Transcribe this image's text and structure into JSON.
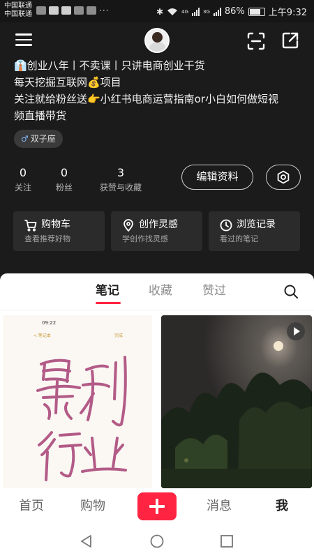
{
  "status_bar": {
    "carrier_1": "中国联通",
    "carrier_2": "中国联通",
    "overflow": "···",
    "net_1": "4G",
    "net_2": "3G",
    "battery": "86%",
    "time": "上午9:32"
  },
  "header": {
    "menu_icon": "hamburger-icon",
    "scan_icon": "scan-icon",
    "share_icon": "share-icon"
  },
  "profile": {
    "bio_lines": [
      "👔创业八年丨不卖课丨只讲电商创业干货",
      "每天挖掘互联网💰项目",
      "关注就给粉丝送👉小红书电商运营指南or小白如何做短视",
      "频直播带货"
    ],
    "tag": "双子座",
    "tag_mark": "♂",
    "stats": [
      {
        "num": "0",
        "label": "关注"
      },
      {
        "num": "0",
        "label": "粉丝"
      },
      {
        "num": "3",
        "label": "获赞与收藏"
      }
    ],
    "edit_button": "编辑资料"
  },
  "cards": [
    {
      "title": "购物车",
      "subtitle": "查看推荐好物",
      "icon": "cart-icon"
    },
    {
      "title": "创作灵感",
      "subtitle": "学创作找灵感",
      "icon": "location-pin-icon"
    },
    {
      "title": "浏览记录",
      "subtitle": "看过的笔记",
      "icon": "clock-icon"
    }
  ],
  "tabs": [
    {
      "label": "笔记",
      "active": true
    },
    {
      "label": "收藏",
      "active": false
    },
    {
      "label": "赞过",
      "active": false
    }
  ],
  "notes": {
    "left": {
      "phone_time": "09:22",
      "back_label": "< 笔记本",
      "done_label": "完成",
      "handwriting": "暴利行业"
    }
  },
  "bottom_nav": [
    {
      "label": "首页",
      "active": false
    },
    {
      "label": "购物",
      "active": false
    },
    {
      "label": "消息",
      "active": false
    },
    {
      "label": "我",
      "active": true
    }
  ],
  "colors": {
    "accent": "#ff2442",
    "dark_bg": "#1b1b1b",
    "card_bg": "#2b2b2b"
  }
}
